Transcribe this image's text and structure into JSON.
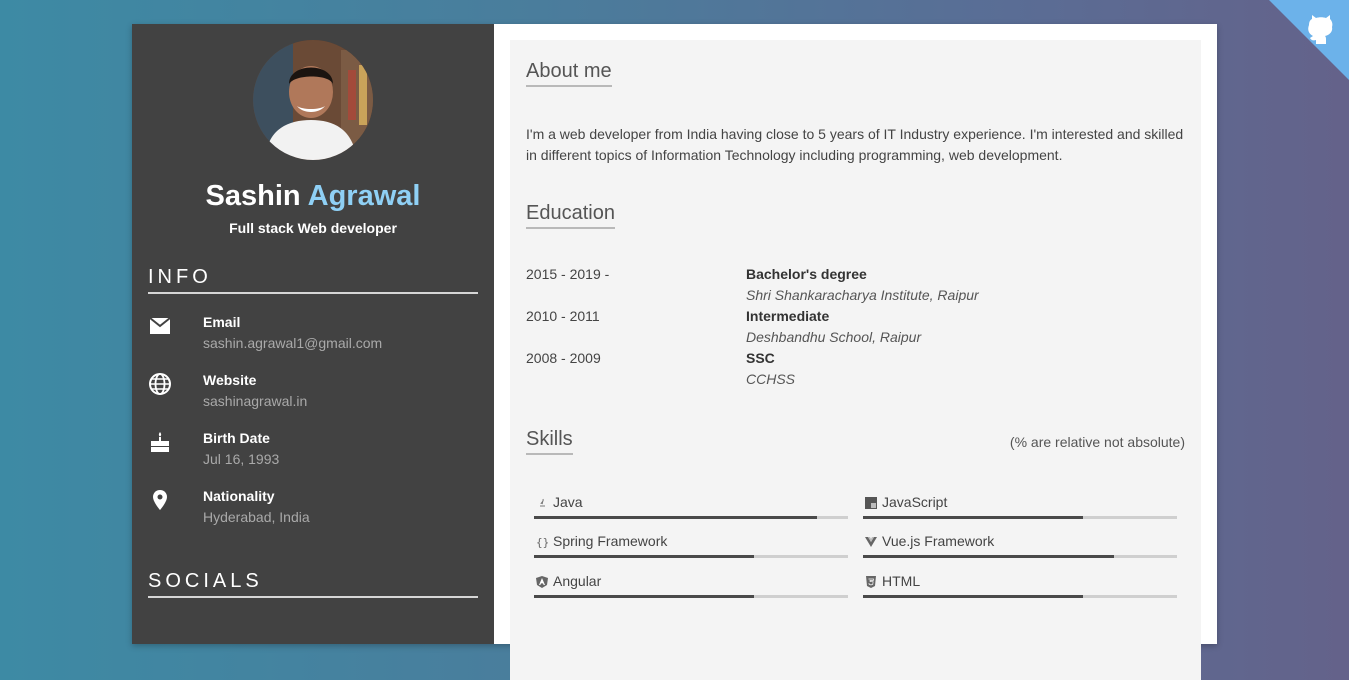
{
  "profile": {
    "first_name": "Sashin",
    "last_name": "Agrawal",
    "role": "Full stack Web developer"
  },
  "sidebar": {
    "info_title": "INFO",
    "socials_title": "SOCIALS",
    "info": [
      {
        "icon": "email-icon",
        "label": "Email",
        "value": "sashin.agrawal1@gmail.com"
      },
      {
        "icon": "globe-icon",
        "label": "Website",
        "value": "sashinagrawal.in"
      },
      {
        "icon": "cake-icon",
        "label": "Birth Date",
        "value": "Jul 16, 1993"
      },
      {
        "icon": "location-pin-icon",
        "label": "Nationality",
        "value": "Hyderabad, India"
      }
    ]
  },
  "about": {
    "title": "About me",
    "text": "I'm a web developer from India having close to 5 years of IT Industry experience. I'm interested and skilled in different topics of Information Technology including programming, web development."
  },
  "education": {
    "title": "Education",
    "items": [
      {
        "years": "2015 - 2019 -",
        "degree": "Bachelor's degree",
        "institution": "Shri Shankaracharya Institute, Raipur"
      },
      {
        "years": "2010 - 2011",
        "degree": "Intermediate",
        "institution": "Deshbandhu School, Raipur"
      },
      {
        "years": "2008 - 2009",
        "degree": "SSC",
        "institution": "CCHSS"
      }
    ]
  },
  "skills": {
    "title": "Skills",
    "note": "(% are relative not absolute)",
    "items": [
      {
        "name": "Java",
        "icon": "java-icon",
        "level": 0.9
      },
      {
        "name": "JavaScript",
        "icon": "javascript-icon",
        "level": 0.7
      },
      {
        "name": "Spring Framework",
        "icon": "braces-icon",
        "level": 0.7
      },
      {
        "name": "Vue.js Framework",
        "icon": "vuejs-icon",
        "level": 0.8
      },
      {
        "name": "Angular",
        "icon": "angular-icon",
        "level": 0.7
      },
      {
        "name": "HTML",
        "icon": "html5-icon",
        "level": 0.7
      }
    ]
  },
  "colors": {
    "sidebar_bg": "#424242",
    "accent_name": "#8fd0f5",
    "corner_ribbon": "#6cb2ea"
  }
}
